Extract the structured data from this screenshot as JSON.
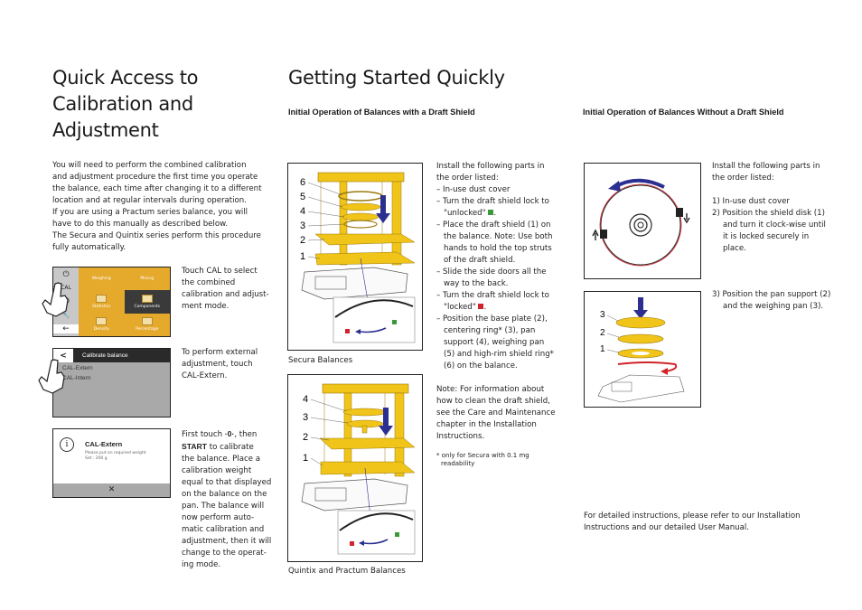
{
  "left": {
    "title_lines": [
      "Quick Access to",
      "Calibration and",
      "Adjustment"
    ],
    "intro_lines": [
      "You will need to perform the combined calibration",
      "and adjustment procedure the first time you operate",
      "the balance, each time after changing it to a different",
      "location and at regular intervals during operation.",
      "If you are using a Practum series balance, you will",
      "have to do this manually as described below.",
      "The Secura and Quintix series perform this procedure",
      "fully automatically."
    ],
    "step1": {
      "text_lines": [
        "Touch CAL to select",
        "the combined",
        "calibration and adjust-",
        "ment mode."
      ],
      "screen": {
        "side": [
          "⏻",
          "CAL",
          "◉",
          "🔧",
          "←"
        ],
        "cells": [
          "Weighing",
          "Mixing",
          "Statistics",
          "Components",
          "Density",
          "Percentage"
        ],
        "selected": "Components"
      }
    },
    "step2": {
      "text_lines": [
        "To perform external",
        "adjustment, touch",
        "CAL-Extern."
      ],
      "screen": {
        "back": "<",
        "title": "Calibrate balance",
        "items": [
          "CAL-Extern",
          "CAL-Intern"
        ]
      }
    },
    "step3": {
      "text_prefix": "First touch ",
      "zero_key": "·0·",
      "text_mid": ", then",
      "start_key": "START",
      "text_after": " to calibrate",
      "text_lines": [
        "the balance. Place a",
        "calibration weight",
        "equal to that displayed",
        "on the balance on the",
        "pan. The balance will",
        "now perform auto-",
        "matic calibration and",
        "adjustment, then it will",
        "change to the operat-",
        "ing mode."
      ],
      "screen": {
        "icon": "i",
        "title": "CAL-Extern",
        "line1": "Please put on required weight",
        "line2": "Set  :    200 g",
        "close": "✕"
      }
    }
  },
  "middle": {
    "title": "Getting Started Quickly",
    "subtitle": "Initial Operation of Balances with a Draft Shield",
    "fig1_labels": [
      "6",
      "5",
      "4",
      "3",
      "2",
      "1"
    ],
    "fig1_caption": "Secura Balances",
    "fig2_labels": [
      "4",
      "3",
      "2",
      "1"
    ],
    "fig2_caption": "Quintix and Practum Balances",
    "instructions": {
      "intro": [
        "Install the following parts in",
        "the order listed:"
      ],
      "items": [
        "– In-use dust cover",
        "– Turn the draft shield lock to \"unlocked\"",
        "– Place the draft shield (1) on the balance. Note: Use both hands to hold the top struts of the draft shield.",
        "– Slide the side doors all the way to the back.",
        "– Turn the draft shield lock to \"locked\"",
        "– Position the base plate (2), centering ring* (3), pan support (4), weighing pan (5) and high-rim shield ring* (6) on the balance."
      ],
      "note": "Note: For information about how to clean the draft shield, see the Care and Maintenance chapter in the Installation Instructions.",
      "footnote": "* only for Secura with 0.1 mg readability"
    }
  },
  "right": {
    "subtitle": "Initial Operation of Balances Without a Draft Shield",
    "intro": [
      "Install the following parts in",
      "the order listed:"
    ],
    "steps": [
      "1) In-use dust cover",
      "2) Position the shield disk (1) and turn it clock-wise until it is locked securely in place."
    ],
    "step3": "3) Position the pan support (2) and the weighing pan (3).",
    "fig_labels": [
      "3",
      "2",
      "1"
    ],
    "footer": [
      "For detailed instructions, please refer to our Installation",
      "Instructions and our detailed User Manual."
    ]
  },
  "colors": {
    "yellow": "#f0c419",
    "navy": "#2b2f8f",
    "red": "#d2232a",
    "green": "#3a9a3a",
    "orange_screen": "#e5a92c"
  }
}
